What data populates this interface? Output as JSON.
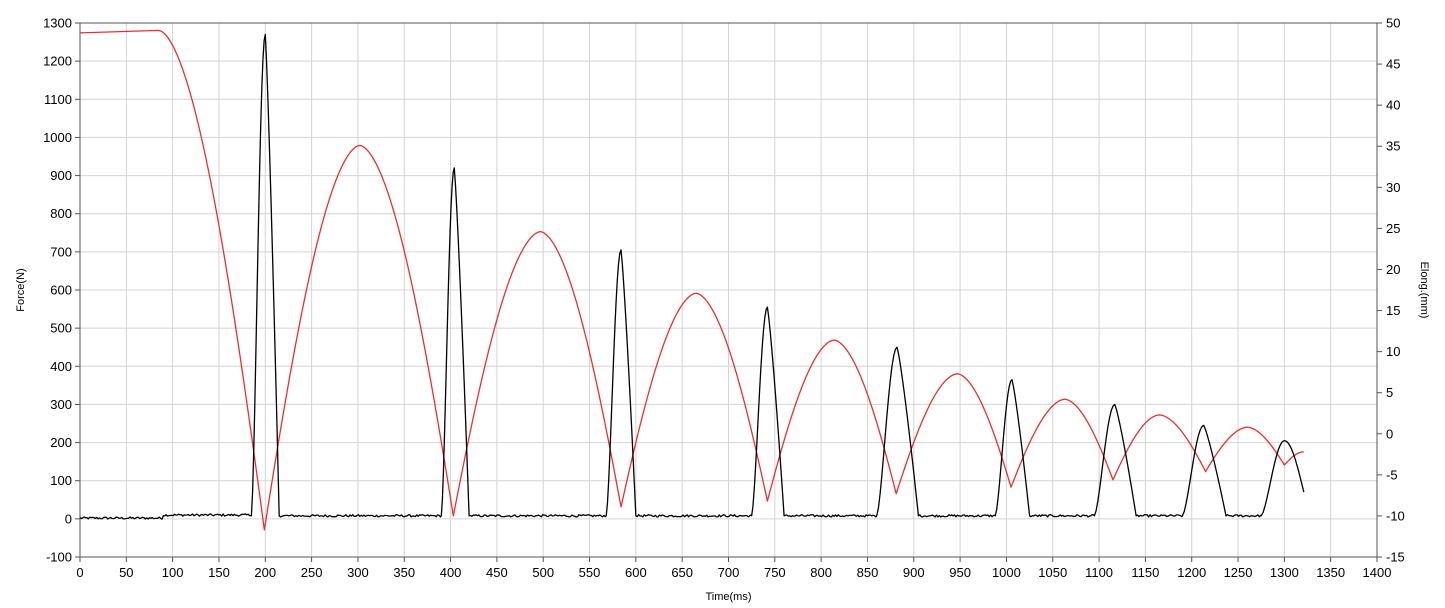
{
  "chart_data": {
    "type": "line",
    "xlabel": "Time(ms)",
    "ylabel_left": "Force(N)",
    "ylabel_right": "Elong.(mm)",
    "xlim": [
      0,
      1400
    ],
    "ylim_left": [
      -100,
      1300
    ],
    "ylim_right": [
      -15,
      50
    ],
    "x_ticks": [
      "0",
      "50",
      "100",
      "150",
      "200",
      "250",
      "300",
      "350",
      "400",
      "450",
      "500",
      "550",
      "600",
      "650",
      "700",
      "750",
      "800",
      "850",
      "900",
      "950",
      "1000",
      "1050",
      "1100",
      "1150",
      "1200",
      "1250",
      "1300",
      "1350",
      "1400"
    ],
    "y_left_ticks": [
      "-100",
      "0",
      "100",
      "200",
      "300",
      "400",
      "500",
      "600",
      "700",
      "800",
      "900",
      "1000",
      "1100",
      "1200",
      "1300"
    ],
    "y_right_ticks": [
      "-15",
      "-10",
      "-5",
      "0",
      "5",
      "10",
      "15",
      "20",
      "25",
      "30",
      "35",
      "40",
      "45",
      "50"
    ],
    "grid": true,
    "series": [
      {
        "axis": "left",
        "color": "#000000",
        "baseline": [
          [
            0,
            2
          ],
          [
            88,
            2
          ],
          [
            90,
            10
          ],
          [
            183,
            10
          ]
        ],
        "pulses": [
          {
            "start": 185,
            "peak_x": 200,
            "peak": 1270,
            "end": 215
          },
          {
            "start": 390,
            "peak_x": 404,
            "peak": 920,
            "end": 420
          },
          {
            "start": 568,
            "peak_x": 584,
            "peak": 705,
            "end": 600
          },
          {
            "start": 725,
            "peak_x": 742,
            "peak": 555,
            "end": 760
          },
          {
            "start": 860,
            "peak_x": 882,
            "peak": 450,
            "end": 905
          },
          {
            "start": 988,
            "peak_x": 1006,
            "peak": 365,
            "end": 1025
          },
          {
            "start": 1095,
            "peak_x": 1117,
            "peak": 300,
            "end": 1140
          },
          {
            "start": 1190,
            "peak_x": 1213,
            "peak": 245,
            "end": 1237
          },
          {
            "start": 1275,
            "peak_x": 1300,
            "peak": 205,
            "end": 1321
          }
        ],
        "end_value": [
          1321,
          70
        ],
        "floor": 8
      },
      {
        "axis": "right",
        "color": "#e8302f",
        "plateau": [
          [
            0,
            48.8
          ],
          [
            85,
            49.1
          ]
        ],
        "maxima": [
          [
            85,
            49.1
          ],
          [
            302,
            35.1
          ],
          [
            497,
            24.6
          ],
          [
            665,
            17.1
          ],
          [
            814,
            11.4
          ],
          [
            947,
            7.3
          ],
          [
            1063,
            4.2
          ],
          [
            1165,
            2.3
          ],
          [
            1260,
            0.8
          ]
        ],
        "minima": [
          [
            199,
            -11.7
          ],
          [
            403,
            -10.0
          ],
          [
            584,
            -8.9
          ],
          [
            742,
            -8.2
          ],
          [
            881,
            -7.3
          ],
          [
            1005,
            -6.5
          ],
          [
            1115,
            -5.6
          ],
          [
            1215,
            -4.6
          ],
          [
            1300,
            -3.8
          ]
        ],
        "end_point": [
          1321,
          -2.2
        ]
      }
    ]
  }
}
